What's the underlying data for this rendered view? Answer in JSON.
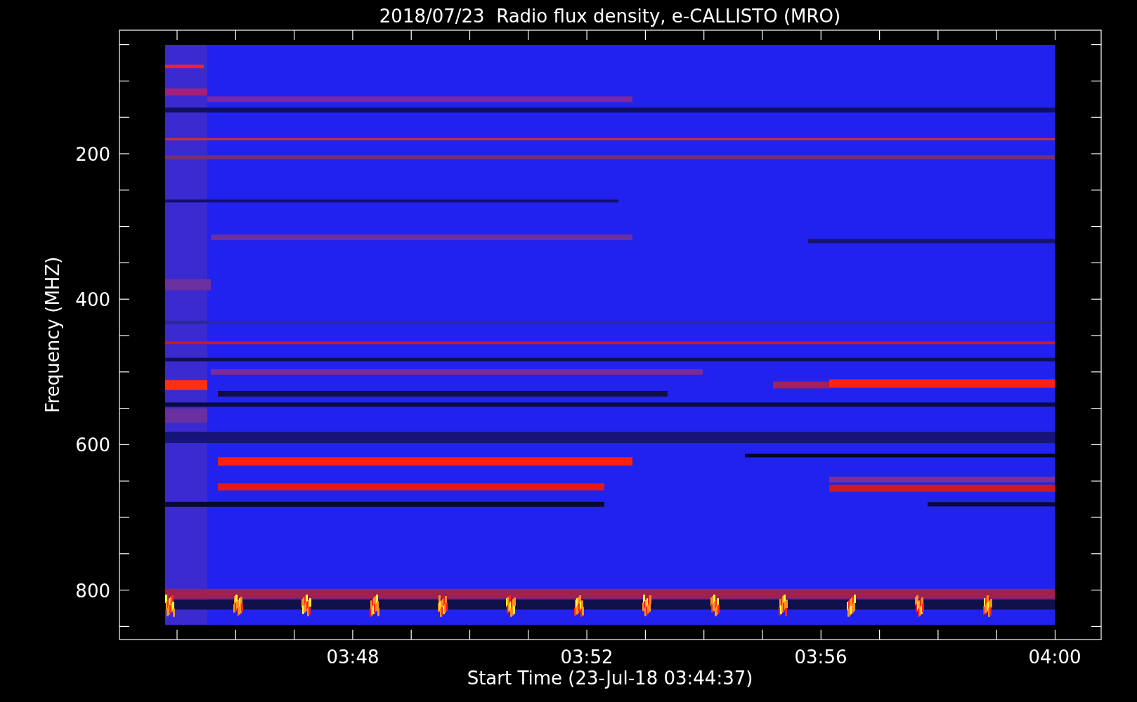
{
  "plot": {
    "title": "2018/07/23  Radio flux density, e-CALLISTO (MRO)",
    "xlabel": "Start Time (23-Jul-18 03:44:37)",
    "ylabel": "Frequency (MHZ)",
    "x_tick_labels": [
      "03:48",
      "03:52",
      "03:56",
      "04:00"
    ],
    "y_tick_labels": [
      "200",
      "400",
      "600",
      "800"
    ]
  }
}
